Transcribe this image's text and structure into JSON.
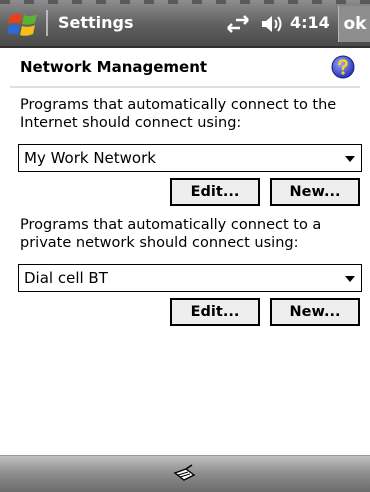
{
  "title_bar": {
    "app_title": "Settings",
    "clock": "4:14",
    "ok_label": "ok",
    "icons": [
      "windows-start-icon",
      "connectivity-icon",
      "volume-icon"
    ]
  },
  "header": {
    "title": "Network Management",
    "help_icon": "help-icon"
  },
  "internet_section": {
    "description": "Programs that automatically connect to the Internet should connect using:",
    "selected": "My Work Network",
    "edit_label": "Edit...",
    "new_label": "New..."
  },
  "private_section": {
    "description": "Programs that automatically connect to a private network should connect using:",
    "selected": "Dial cell BT",
    "edit_label": "Edit...",
    "new_label": "New..."
  },
  "menu_bar": {
    "icons": [
      "input-panel-icon"
    ]
  },
  "colors": {
    "titlebar": "#5f5f5f",
    "text": "#000000",
    "button_face": "#eeeeee"
  }
}
